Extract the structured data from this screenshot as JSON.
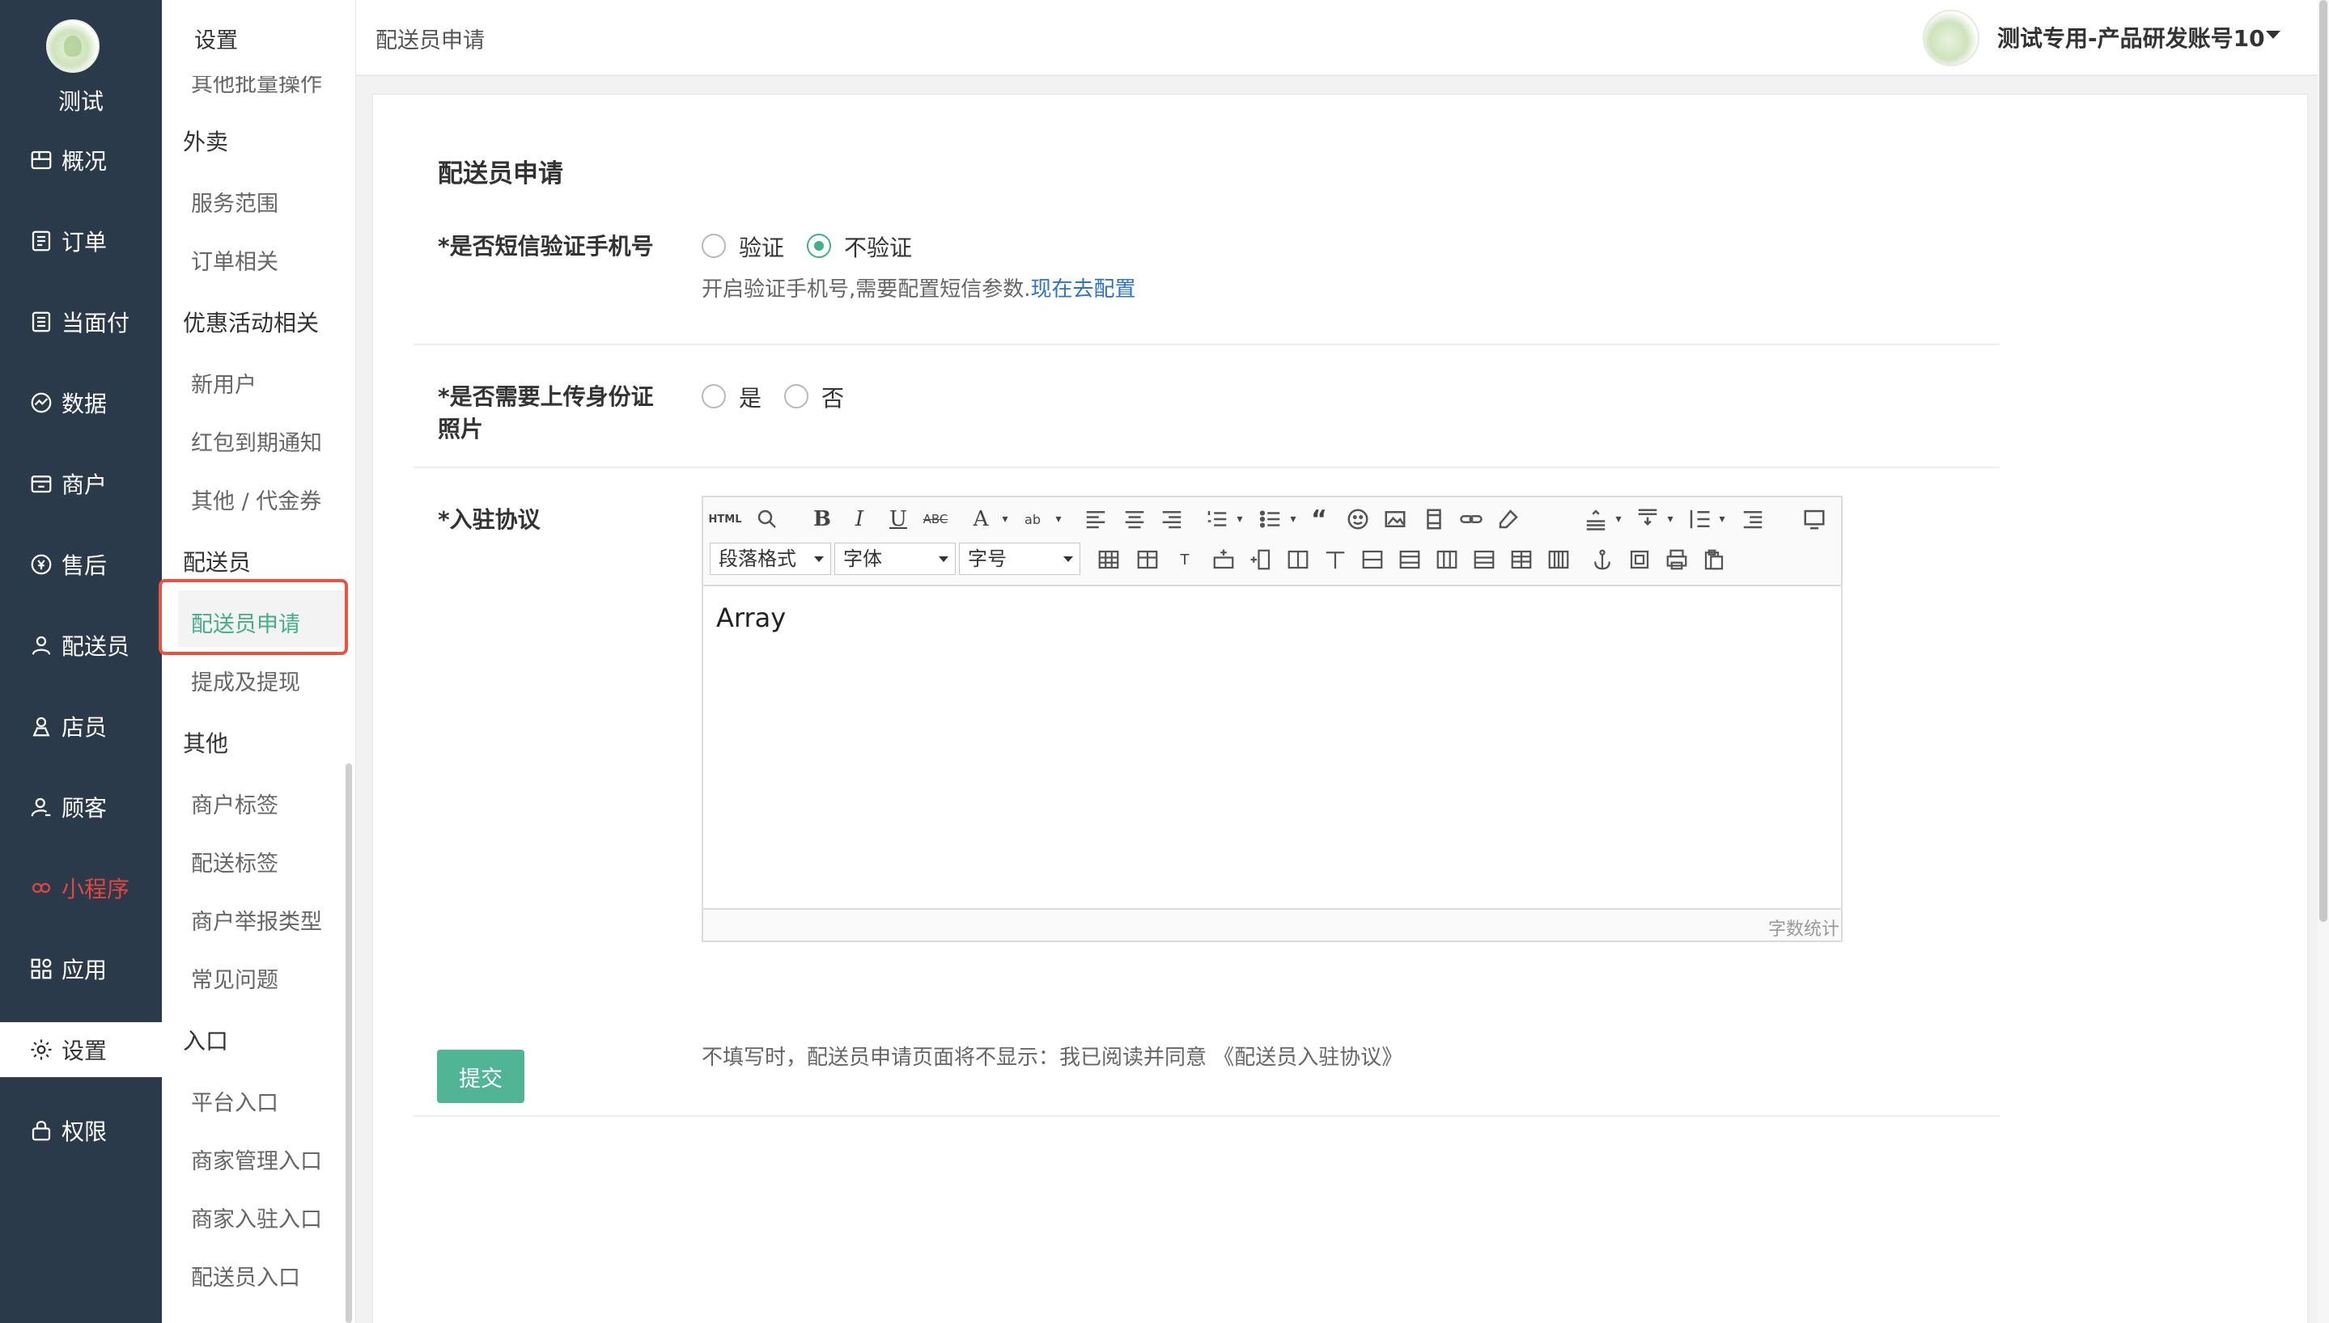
{
  "nav": {
    "logo_name": "测试",
    "items": [
      {
        "label": "概况",
        "icon": "dashboard-icon"
      },
      {
        "label": "订单",
        "icon": "order-icon"
      },
      {
        "label": "当面付",
        "icon": "pay-icon"
      },
      {
        "label": "数据",
        "icon": "chart-icon"
      },
      {
        "label": "商户",
        "icon": "store-icon"
      },
      {
        "label": "售后",
        "icon": "service-icon"
      },
      {
        "label": "配送员",
        "icon": "courier-icon"
      },
      {
        "label": "店员",
        "icon": "clerk-icon"
      },
      {
        "label": "顾客",
        "icon": "customer-icon"
      },
      {
        "label": "小程序",
        "icon": "miniapp-icon"
      },
      {
        "label": "应用",
        "icon": "apps-icon"
      },
      {
        "label": "设置",
        "icon": "gear-icon"
      },
      {
        "label": "权限",
        "icon": "lock-icon"
      }
    ]
  },
  "subnav": {
    "title": "设置",
    "cut_item": "其他批量操作",
    "groups": {
      "takeout": "外卖",
      "promo": "优惠活动相关",
      "courier": "配送员",
      "other": "其他",
      "entry": "入口"
    },
    "items": {
      "service_area": "服务范围",
      "order_related": "订单相关",
      "new_user": "新用户",
      "redpacket": "红包到期通知",
      "voucher": "其他 / 代金券",
      "courier_apply": "配送员申请",
      "commission": "提成及提现",
      "merchant_tag": "商户标签",
      "delivery_tag": "配送标签",
      "report_type": "商户举报类型",
      "faq": "常见问题",
      "platform_entry": "平台入口",
      "merchant_mgmt_entry": "商家管理入口",
      "merchant_join_entry": "商家入驻入口",
      "courier_entry": "配送员入口"
    }
  },
  "header": {
    "breadcrumb": "配送员申请",
    "account": "测试专用-产品研发账号10"
  },
  "form": {
    "section_title": "配送员申请",
    "sms": {
      "label": "*是否短信验证手机号",
      "opt_yes": "验证",
      "opt_no": "不验证",
      "hint": "开启验证手机号,需要配置短信参数.",
      "hint_link": "现在去配置"
    },
    "idcard": {
      "label_line1": "*是否需要上传身份证",
      "label_line2": "照片",
      "opt_yes": "是",
      "opt_no": "否"
    },
    "agreement": {
      "label": "*入驻协议",
      "toolbar": {
        "paragraph": "段落格式",
        "font": "字体",
        "size": "字号"
      },
      "content": "Array",
      "word_count": "字数统计",
      "hint": "不填写时，配送员申请页面将不显示：我已阅读并同意 《配送员入驻协议》"
    },
    "submit": "提交"
  }
}
